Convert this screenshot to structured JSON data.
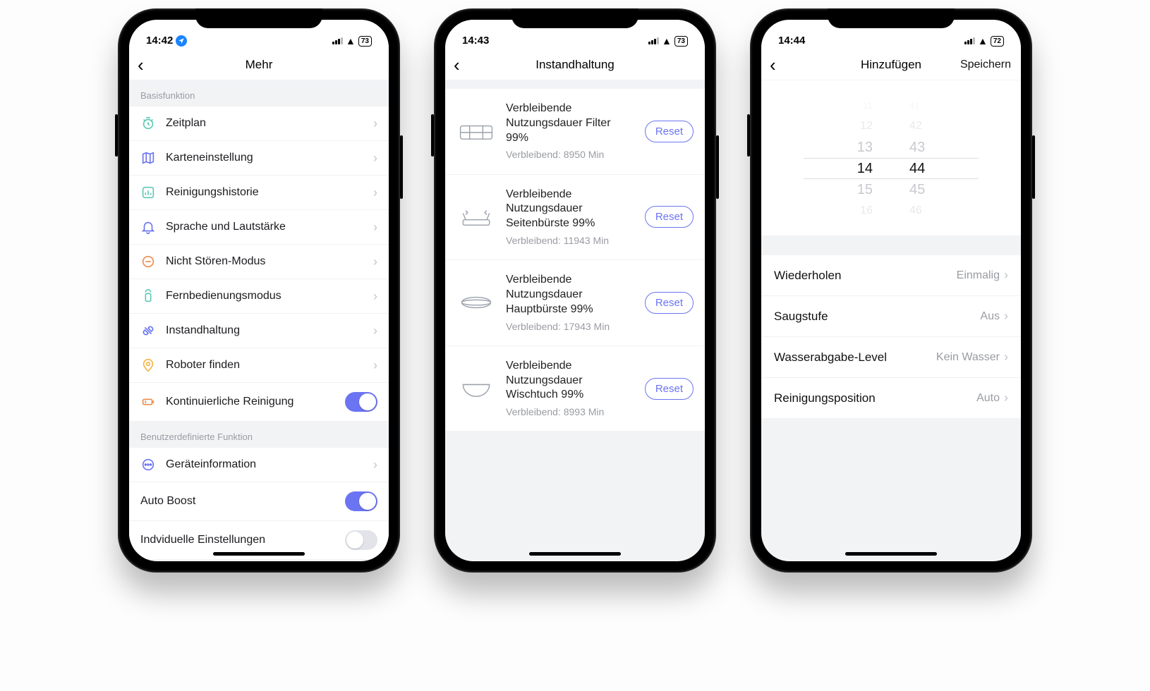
{
  "phone1": {
    "status": {
      "time": "14:42",
      "battery": "73"
    },
    "title": "Mehr",
    "section1_title": "Basisfunktion",
    "rows": [
      {
        "label": "Zeitplan"
      },
      {
        "label": "Karteneinstellung"
      },
      {
        "label": "Reinigungshistorie"
      },
      {
        "label": "Sprache und Lautstärke"
      },
      {
        "label": "Nicht Stören-Modus"
      },
      {
        "label": "Fernbedienungsmodus"
      },
      {
        "label": "Instandhaltung"
      },
      {
        "label": "Roboter finden"
      },
      {
        "label": "Kontinuierliche Reinigung"
      }
    ],
    "section2_title": "Benutzerdefinierte Funktion",
    "rows2": [
      {
        "label": "Geräteinformation"
      },
      {
        "label": "Auto Boost"
      },
      {
        "label": "Indviduelle Einstellungen"
      }
    ]
  },
  "phone2": {
    "status": {
      "time": "14:43",
      "battery": "73"
    },
    "title": "Instandhaltung",
    "reset_label": "Reset",
    "items": [
      {
        "title": "Verbleibende Nutzungsdauer Filter 99%",
        "sub": "Verbleibend: 8950 Min"
      },
      {
        "title": "Verbleibende Nutzungsdauer Seitenbürste 99%",
        "sub": "Verbleibend: 11943 Min"
      },
      {
        "title": "Verbleibende Nutzungsdauer Hauptbürste 99%",
        "sub": "Verbleibend: 17943 Min"
      },
      {
        "title": "Verbleibende Nutzungsdauer Wischtuch 99%",
        "sub": "Verbleibend: 8993 Min"
      }
    ]
  },
  "phone3": {
    "status": {
      "time": "14:44",
      "battery": "72"
    },
    "title": "Hinzufügen",
    "save": "Speichern",
    "picker": {
      "hours": [
        "11",
        "12",
        "13",
        "14",
        "15",
        "16"
      ],
      "mins": [
        "41",
        "42",
        "43",
        "44",
        "45",
        "46"
      ],
      "sel_hour": "14",
      "sel_min": "44"
    },
    "settings": [
      {
        "label": "Wiederholen",
        "value": "Einmalig"
      },
      {
        "label": "Saugstufe",
        "value": "Aus"
      },
      {
        "label": "Wasserabgabe-Level",
        "value": "Kein Wasser"
      },
      {
        "label": "Reinigungsposition",
        "value": "Auto"
      }
    ]
  }
}
